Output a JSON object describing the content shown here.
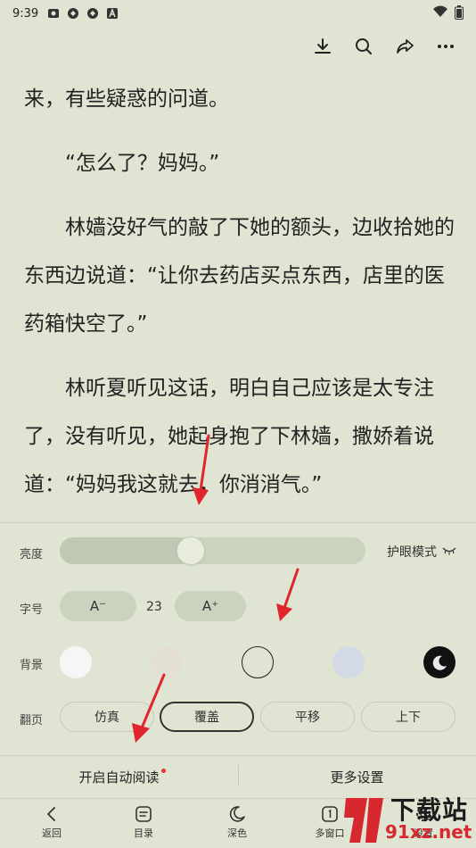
{
  "status_bar": {
    "time": "9:39"
  },
  "toolbar": {
    "icons": [
      "download-icon",
      "search-icon",
      "share-icon",
      "more-icon"
    ]
  },
  "reader": {
    "paragraphs": [
      "来，有些疑惑的问道。",
      "“怎么了？妈妈。”",
      "林嫱没好气的敲了下她的额头，边收拾她的东西边说道：“让你去药店买点东西，店里的医药箱快空了。”",
      "林听夏听见这话，明白自己应该是太专注了，没有听见，她起身抱了下林嫱，撒娇着说道：“妈妈我这就去，你消消气。”"
    ]
  },
  "settings": {
    "brightness": {
      "label": "亮度",
      "level": 0.43,
      "eye_mode_label": "护眼模式"
    },
    "font": {
      "label": "字号",
      "decrease_label": "A⁻",
      "increase_label": "A⁺",
      "size": "23"
    },
    "background": {
      "label": "背景",
      "colors": [
        "#f6f6f6",
        "#e3e0d3",
        "#dfe5d2",
        "#d3dae6",
        "#111111"
      ],
      "selected_index": 2
    },
    "page_turn": {
      "label": "翻页",
      "options": [
        "仿真",
        "覆盖",
        "平移",
        "上下"
      ],
      "selected_index": 1
    },
    "auto_read_label": "开启自动阅读",
    "more_settings_label": "更多设置"
  },
  "bottom_nav": [
    {
      "label": "返回",
      "icon": "back-icon"
    },
    {
      "label": "目录",
      "icon": "catalog-icon"
    },
    {
      "label": "深色",
      "icon": "moon-icon"
    },
    {
      "label": "多窗口",
      "icon": "multi-window-icon"
    },
    {
      "label": "设置",
      "icon": "gear-icon"
    }
  ],
  "watermark": {
    "brand": "下载站",
    "url": "91xz.net"
  },
  "colors": {
    "background": "#dfe5d2",
    "arrow": "#e0262d",
    "accent_dot": "#e8333b"
  }
}
